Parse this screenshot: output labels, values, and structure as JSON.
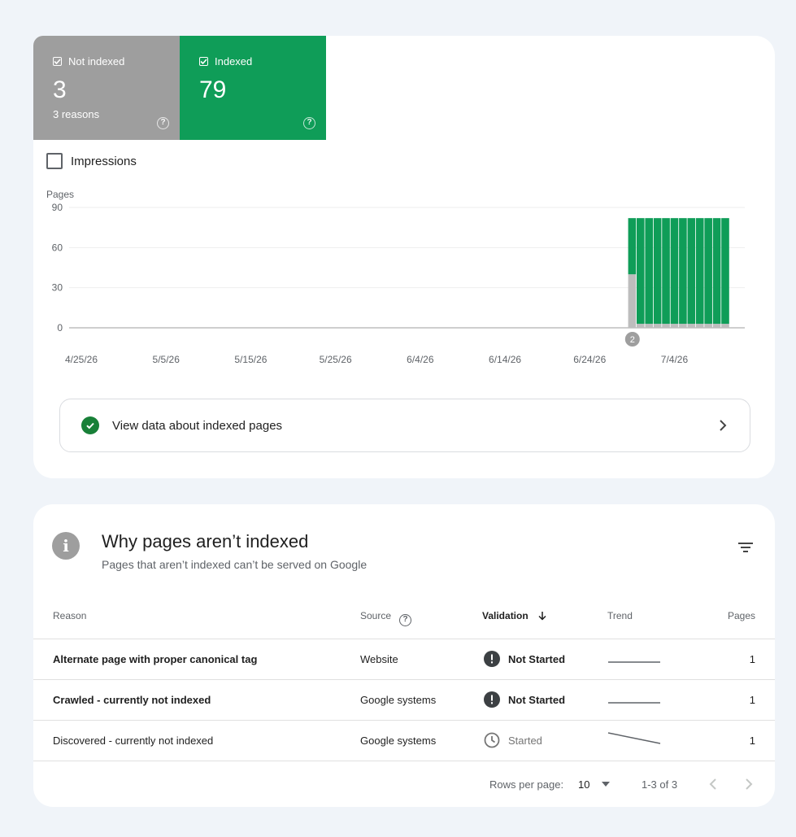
{
  "tiles": {
    "not_indexed": {
      "label": "Not indexed",
      "count": "3",
      "sub": "3 reasons",
      "checked": true
    },
    "indexed": {
      "label": "Indexed",
      "count": "79",
      "checked": true
    }
  },
  "impressions": {
    "label": "Impressions",
    "checked": false
  },
  "chart_data": {
    "type": "bar",
    "stacked": true,
    "ylabel": "Pages",
    "ylim": [
      0,
      90
    ],
    "yticks": [
      90,
      60,
      30,
      0
    ],
    "xticks": [
      "4/25/26",
      "5/5/26",
      "5/15/26",
      "5/25/26",
      "6/4/26",
      "6/14/26",
      "6/24/26",
      "7/4/26"
    ],
    "x": [
      "6/29/26",
      "6/30/26",
      "7/1/26",
      "7/2/26",
      "7/3/26",
      "7/4/26",
      "7/5/26",
      "7/6/26",
      "7/7/26",
      "7/8/26",
      "7/9/26",
      "7/10/26"
    ],
    "series": [
      {
        "name": "Not indexed",
        "color": "#bdbdbd",
        "values": [
          40,
          3,
          3,
          3,
          3,
          3,
          3,
          3,
          3,
          3,
          3,
          3
        ]
      },
      {
        "name": "Indexed",
        "color": "#0f9d58",
        "values": [
          42,
          79,
          79,
          79,
          79,
          79,
          79,
          79,
          79,
          79,
          79,
          79
        ]
      }
    ],
    "annotation": {
      "label": "2",
      "x": "6/30/26"
    },
    "grid": true
  },
  "view_button": {
    "label": "View data about indexed pages"
  },
  "why": {
    "title": "Why pages aren’t indexed",
    "subtitle": "Pages that aren’t indexed can’t be served on Google",
    "columns": {
      "reason": "Reason",
      "source": "Source",
      "validation": "Validation",
      "trend": "Trend",
      "pages": "Pages"
    },
    "rows": [
      {
        "reason": "Alternate page with proper canonical tag",
        "source": "Website",
        "validation": "Not Started",
        "status": "not-started",
        "pages": "1",
        "trend": "flat"
      },
      {
        "reason": "Crawled - currently not indexed",
        "source": "Google systems",
        "validation": "Not Started",
        "status": "not-started",
        "pages": "1",
        "trend": "flat"
      },
      {
        "reason": "Discovered - currently not indexed",
        "source": "Google systems",
        "validation": "Started",
        "status": "started",
        "pages": "1",
        "trend": "down"
      }
    ]
  },
  "pager": {
    "rows_label": "Rows per page:",
    "rows_value": "10",
    "range": "1-3 of 3"
  },
  "colors": {
    "indexed": "#0f9d58",
    "not_indexed": "#9e9e9e",
    "background": "#f0f4f9"
  }
}
